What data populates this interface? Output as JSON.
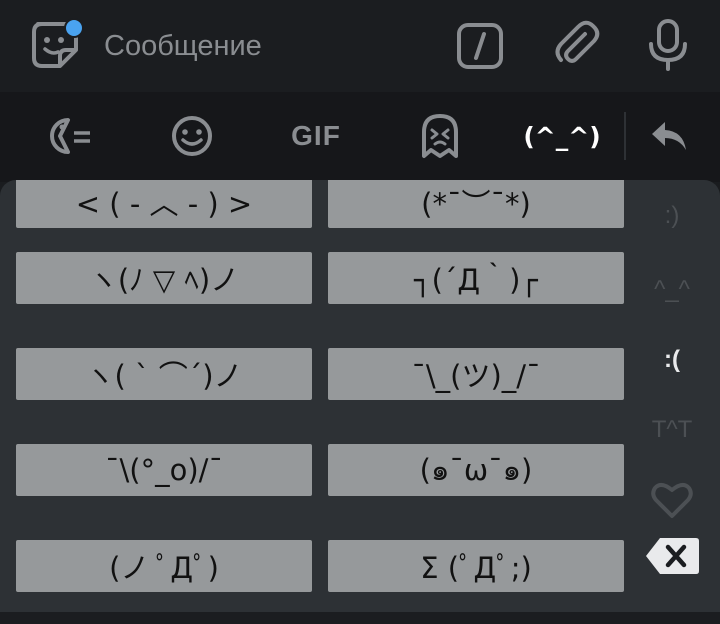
{
  "compose": {
    "placeholder": "Сообщение",
    "icons": [
      "sticker-icon",
      "command-slash-icon",
      "paperclip-icon",
      "microphone-icon"
    ],
    "dot_color": "#4aa3f0"
  },
  "tabs": {
    "gif_label": "GIF",
    "kaomoji_label": "(^_^)",
    "icons": [
      "recent-emoji-icon",
      "smiley-icon",
      "sticker-ghost-icon",
      "back-arrow-icon"
    ]
  },
  "kaomoji": [
    [
      "< ( - ︿ - ) >",
      "(*¯︶¯*)"
    ],
    [
      "ヽ(ﾉ ▽ ﾍ)ノ",
      "┐(´Д｀)┌"
    ],
    [
      "ヽ( ` ⌒´)ノ",
      "¯\\_(ツ)_/¯"
    ],
    [
      "¯\\(°_o)/¯",
      "(๑¯ω¯๑)"
    ],
    [
      "(ノ ﾟДﾟ)",
      "Σ (ﾟДﾟ;)"
    ]
  ],
  "categories": {
    "happy": ":)",
    "joy": "^_^",
    "sad": ":(",
    "cry": "T^T"
  },
  "colors": {
    "tile": "#96999b",
    "panel": "#2d3135",
    "active": "#e9eaec",
    "dim": "#4c5054"
  }
}
